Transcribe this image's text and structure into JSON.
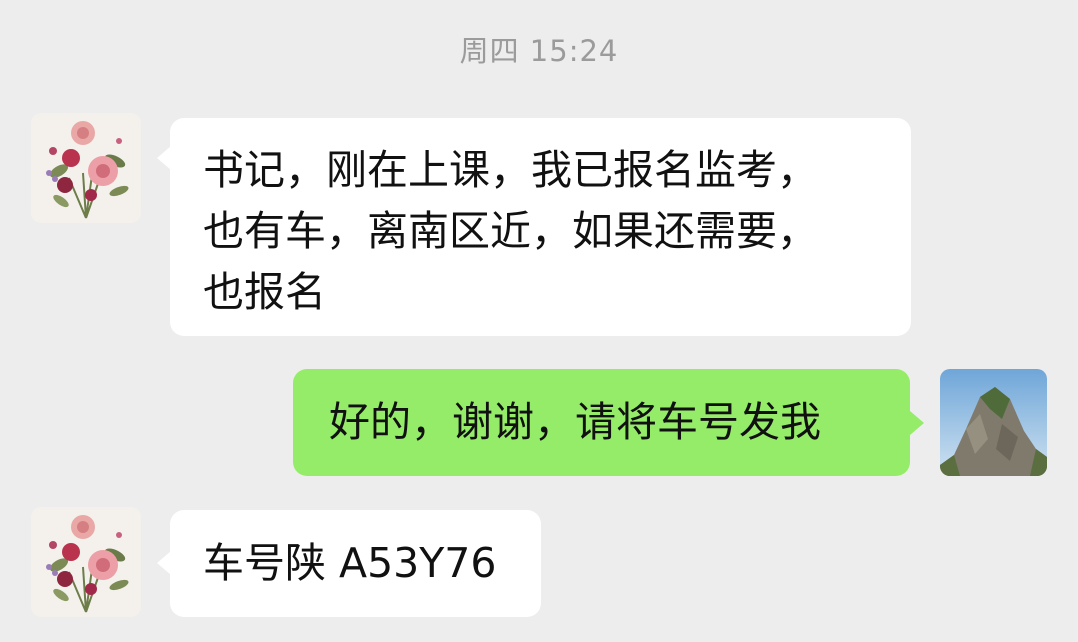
{
  "conversation": {
    "timestamp": "周四 15:24",
    "messages": [
      {
        "direction": "incoming",
        "avatar": "flower-bouquet-avatar",
        "text": "书记，刚在上课，我已报名监考，\n也有车，离南区近，如果还需要，\n也报名"
      },
      {
        "direction": "outgoing",
        "avatar": "mountain-peak-avatar",
        "text": "好的，谢谢，请将车号发我"
      },
      {
        "direction": "incoming",
        "avatar": "flower-bouquet-avatar",
        "text": "车号陕 A53Y76"
      }
    ]
  },
  "colors": {
    "background": "#ededed",
    "incoming_bubble": "#ffffff",
    "outgoing_bubble": "#95ec69",
    "timestamp_text": "#9b9b9b",
    "message_text": "#111111"
  }
}
